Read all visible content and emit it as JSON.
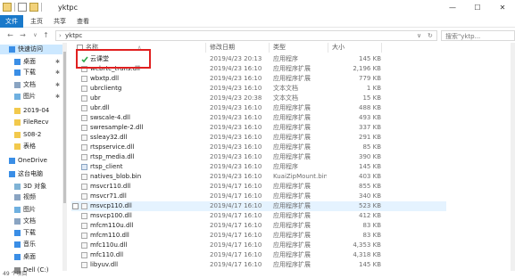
{
  "window": {
    "title": "yktpc",
    "minimize": "—",
    "maximize": "☐",
    "close": "✕"
  },
  "ribbon": {
    "tabs": [
      "文件",
      "主页",
      "共享",
      "查看"
    ]
  },
  "address": {
    "back": "←",
    "forward": "→",
    "up": "↑",
    "path": [
      "yktpc"
    ],
    "dropdown": "∨",
    "refresh": "↻",
    "search_placeholder": "搜索\"yktp..."
  },
  "sidebar": {
    "items": [
      {
        "label": "快速访问",
        "icon": "star-icon",
        "pinned": false
      },
      {
        "label": "桌面",
        "icon": "desktop-icon",
        "pinned": true
      },
      {
        "label": "下载",
        "icon": "download-icon",
        "pinned": true
      },
      {
        "label": "文档",
        "icon": "document-icon",
        "pinned": true
      },
      {
        "label": "图片",
        "icon": "picture-icon",
        "pinned": true
      },
      {
        "label": "2019-04",
        "icon": "folder-icon",
        "pinned": false
      },
      {
        "label": "FileRecv",
        "icon": "folder-icon",
        "pinned": false
      },
      {
        "label": "S08-2",
        "icon": "folder-icon",
        "pinned": false
      },
      {
        "label": "表格",
        "icon": "folder-icon",
        "pinned": false
      },
      {
        "label": "OneDrive",
        "icon": "cloud-icon",
        "pinned": false
      },
      {
        "label": "这台电脑",
        "icon": "computer-icon",
        "pinned": false
      },
      {
        "label": "3D 对象",
        "icon": "cube-icon",
        "pinned": false
      },
      {
        "label": "视频",
        "icon": "video-icon",
        "pinned": false
      },
      {
        "label": "图片",
        "icon": "picture-icon",
        "pinned": false
      },
      {
        "label": "文档",
        "icon": "document-icon",
        "pinned": false
      },
      {
        "label": "下载",
        "icon": "download-icon",
        "pinned": false
      },
      {
        "label": "音乐",
        "icon": "music-icon",
        "pinned": false
      },
      {
        "label": "桌面",
        "icon": "desktop-icon",
        "pinned": false
      },
      {
        "label": "Dell (C:)",
        "icon": "drive-icon",
        "pinned": false
      }
    ]
  },
  "columns": {
    "name": "名称",
    "date": "修改日期",
    "type": "类型",
    "size": "大小"
  },
  "files": [
    {
      "name": "云课堂",
      "date": "2019/4/23 20:13",
      "type": "应用程序",
      "size": "145 KB",
      "icon": "app"
    },
    {
      "name": "webrtc_trans.dll",
      "date": "2019/4/23 16:10",
      "type": "应用程序扩展",
      "size": "2,196 KB",
      "icon": "dll"
    },
    {
      "name": "wbxtp.dll",
      "date": "2019/4/23 16:10",
      "type": "应用程序扩展",
      "size": "779 KB",
      "icon": "dll"
    },
    {
      "name": "ubrclientg",
      "date": "2019/4/23 16:10",
      "type": "文本文档",
      "size": "1 KB",
      "icon": "txt"
    },
    {
      "name": "ubr",
      "date": "2019/4/23 20:38",
      "type": "文本文档",
      "size": "15 KB",
      "icon": "txt"
    },
    {
      "name": "ubr.dll",
      "date": "2019/4/23 16:10",
      "type": "应用程序扩展",
      "size": "488 KB",
      "icon": "dll"
    },
    {
      "name": "swscale-4.dll",
      "date": "2019/4/23 16:10",
      "type": "应用程序扩展",
      "size": "493 KB",
      "icon": "dll"
    },
    {
      "name": "swresample-2.dll",
      "date": "2019/4/23 16:10",
      "type": "应用程序扩展",
      "size": "337 KB",
      "icon": "dll"
    },
    {
      "name": "ssleay32.dll",
      "date": "2019/4/23 16:10",
      "type": "应用程序扩展",
      "size": "291 KB",
      "icon": "dll"
    },
    {
      "name": "rtspservice.dll",
      "date": "2019/4/23 16:10",
      "type": "应用程序扩展",
      "size": "85 KB",
      "icon": "dll"
    },
    {
      "name": "rtsp_media.dll",
      "date": "2019/4/23 16:10",
      "type": "应用程序扩展",
      "size": "390 KB",
      "icon": "dll"
    },
    {
      "name": "rtsp_client",
      "date": "2019/4/23 16:10",
      "type": "应用程序",
      "size": "145 KB",
      "icon": "app"
    },
    {
      "name": "natives_blob.bin",
      "date": "2019/4/23 16:10",
      "type": "KuaiZipMount.bin",
      "size": "403 KB",
      "icon": "bin"
    },
    {
      "name": "msvcr110.dll",
      "date": "2019/4/17 16:10",
      "type": "应用程序扩展",
      "size": "855 KB",
      "icon": "dll"
    },
    {
      "name": "msvcr71.dll",
      "date": "2019/4/17 16:10",
      "type": "应用程序扩展",
      "size": "340 KB",
      "icon": "dll"
    },
    {
      "name": "msvcp110.dll",
      "date": "2019/4/17 16:10",
      "type": "应用程序扩展",
      "size": "523 KB",
      "icon": "dll",
      "hover": true
    },
    {
      "name": "msvcp100.dll",
      "date": "2019/4/17 16:10",
      "type": "应用程序扩展",
      "size": "412 KB",
      "icon": "dll"
    },
    {
      "name": "mfcm110u.dll",
      "date": "2019/4/17 16:10",
      "type": "应用程序扩展",
      "size": "83 KB",
      "icon": "dll"
    },
    {
      "name": "mfcm110.dll",
      "date": "2019/4/17 16:10",
      "type": "应用程序扩展",
      "size": "83 KB",
      "icon": "dll"
    },
    {
      "name": "mfc110u.dll",
      "date": "2019/4/17 16:10",
      "type": "应用程序扩展",
      "size": "4,353 KB",
      "icon": "dll"
    },
    {
      "name": "mfc110.dll",
      "date": "2019/4/17 16:10",
      "type": "应用程序扩展",
      "size": "4,318 KB",
      "icon": "dll"
    },
    {
      "name": "libyuv.dll",
      "date": "2019/4/17 16:10",
      "type": "应用程序扩展",
      "size": "145 KB",
      "icon": "dll"
    }
  ],
  "status": {
    "count": "49 个项目"
  },
  "colors": {
    "accent": "#1979ca",
    "highlight_box": "#e02020",
    "hover_row": "#e5f3ff"
  }
}
